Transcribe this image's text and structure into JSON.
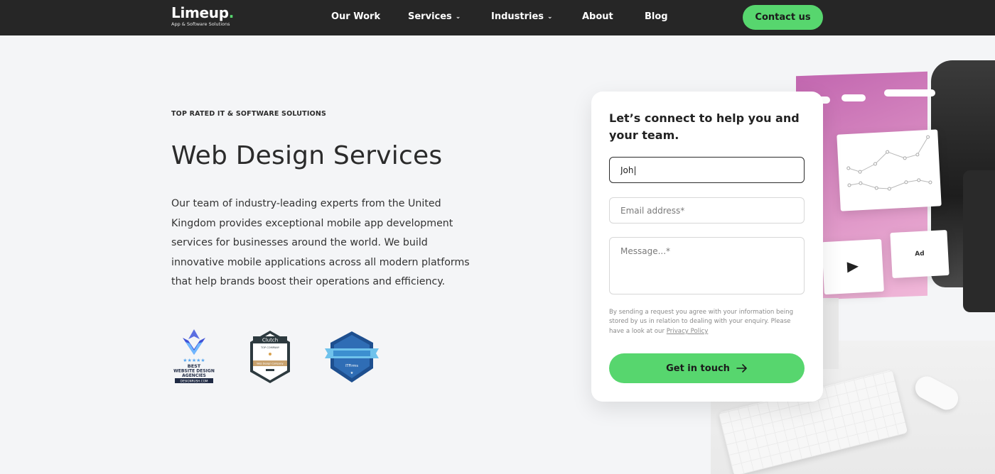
{
  "nav": {
    "logo_word": "Limeup",
    "logo_dot": ".",
    "logo_tagline": "App & Software Solutions",
    "links": [
      {
        "label": "Our Work",
        "has_dropdown": false
      },
      {
        "label": "Services",
        "has_dropdown": true
      },
      {
        "label": "Industries",
        "has_dropdown": true
      },
      {
        "label": "About",
        "has_dropdown": false
      },
      {
        "label": "Blog",
        "has_dropdown": false
      }
    ],
    "cta_label": "Contact us",
    "chevron_icon": "chevron-down-icon"
  },
  "hero": {
    "eyebrow": "TOP RATED IT & SOFTWARE SOLUTIONS",
    "title": "Web Design Services",
    "body": "Our team of industry-leading experts from the United Kingdom provides exceptional mobile app development services for businesses around the world. We build innovative mobile applications across all modern platforms that help brands boost their operations and efficiency."
  },
  "badges": {
    "designrush": {
      "line1": "BEST",
      "line2": "WEBSITE DESIGN",
      "line3": "AGENCIES",
      "site": "DESIGNRUSH.COM"
    },
    "clutch": {
      "brand": "Clutch",
      "top": "TOP COMPANY",
      "category": "Web Design Company"
    },
    "itfirms": {
      "brand": "ITFirms"
    }
  },
  "illustration": {
    "ad_label": "Ad",
    "play_icon": "play-icon"
  },
  "form": {
    "heading": "Let’s connect to help you and your team.",
    "name_value": "Joh|",
    "email_placeholder": "Email address*",
    "message_placeholder": "Message...*",
    "consent_text": "By sending a request you agree with your information being stored by us in relation to dealing with your enquiry. Please have a look at our ",
    "privacy_link": "Privacy Policy",
    "submit_label": "Get in touch",
    "submit_icon": "arrow-right-icon"
  },
  "colors": {
    "accent_green": "#57d66e",
    "nav_bg": "#262626",
    "page_bg": "#f4f5f7"
  }
}
